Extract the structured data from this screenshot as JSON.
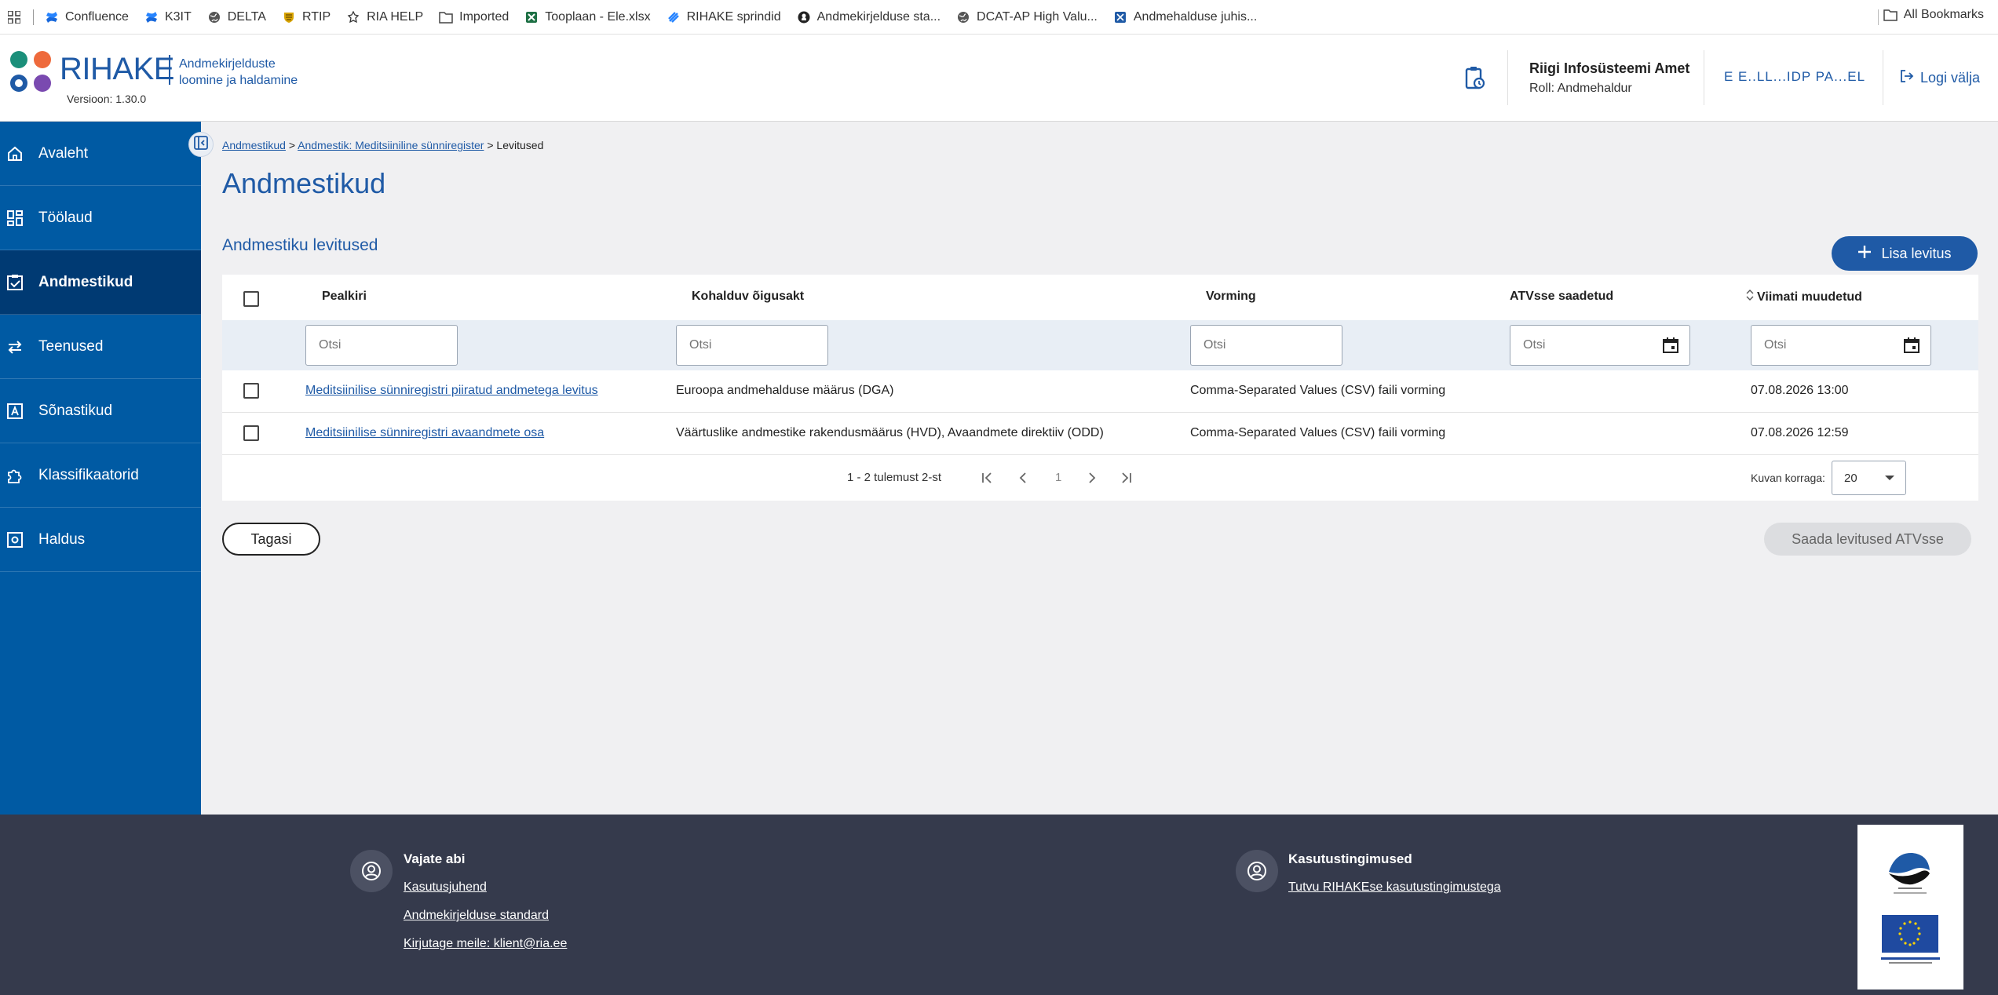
{
  "bookmarks": {
    "items": [
      {
        "label": "Confluence",
        "icon": "confluence-icon"
      },
      {
        "label": "K3IT",
        "icon": "confluence-icon"
      },
      {
        "label": "DELTA",
        "icon": "globe-icon"
      },
      {
        "label": "RTIP",
        "icon": "crest-icon"
      },
      {
        "label": "RIA HELP",
        "icon": "ria-icon"
      },
      {
        "label": "Imported",
        "icon": "folder-icon"
      },
      {
        "label": "Tooplaan - Ele.xlsx",
        "icon": "excel-icon"
      },
      {
        "label": "RIHAKE sprindid",
        "icon": "jira-icon"
      },
      {
        "label": "Andmekirjelduse sta...",
        "icon": "github-icon"
      },
      {
        "label": "DCAT-AP High Valu...",
        "icon": "globe-icon"
      },
      {
        "label": "Andmehalduse juhis...",
        "icon": "doc-icon"
      }
    ],
    "all_label": "All Bookmarks"
  },
  "header": {
    "logo": "RIHAKE",
    "subtitle_line1": "Andmekirjelduste",
    "subtitle_line2": "loomine ja haldamine",
    "version": "Versioon: 1.30.0",
    "org": "Riigi Infosüsteemi Amet",
    "role": "Roll: Andmehaldur",
    "panel": "E E..LL...IDP PA...EL",
    "logout": "Logi välja"
  },
  "sidebar": {
    "items": [
      {
        "label": "Avaleht",
        "icon": "home-icon",
        "active": false
      },
      {
        "label": "Töölaud",
        "icon": "dashboard-icon",
        "active": false
      },
      {
        "label": "Andmestikud",
        "icon": "dataset-check-icon",
        "active": true
      },
      {
        "label": "Teenused",
        "icon": "swap-arrows-icon",
        "active": false
      },
      {
        "label": "Sõnastikud",
        "icon": "dictionary-icon",
        "active": false
      },
      {
        "label": "Klassifikaatorid",
        "icon": "puzzle-icon",
        "active": false
      },
      {
        "label": "Haldus",
        "icon": "settings-box-icon",
        "active": false
      }
    ]
  },
  "breadcrumb": {
    "link1": "Andmestikud",
    "sep": " > ",
    "link2": "Andmestik: Meditsiiniline sünniregister",
    "current": "Levitused"
  },
  "page": {
    "title": "Andmestikud",
    "section": "Andmestiku levitused",
    "add_button": "Lisa levitus",
    "back_button": "Tagasi",
    "send_button": "Saada levitused ATVsse"
  },
  "table": {
    "columns": [
      "Pealkiri",
      "Kohalduv õigusakt",
      "Vorming",
      "ATVsse saadetud",
      "Viimati muudetud"
    ],
    "filter_placeholder": "Otsi",
    "rows": [
      {
        "title": "Meditsiinilise sünniregistri piiratud andmetega levitus",
        "law": "Euroopa andmehalduse määrus (DGA)",
        "format": "Comma-Separated Values (CSV) faili vorming",
        "sent": "",
        "modified": "07.08.2026 13:00"
      },
      {
        "title": "Meditsiinilise sünniregistri avaandmete osa",
        "law": "Väärtuslike andmestike rakendusmäärus (HVD), Avaandmete direktiiv (ODD)",
        "format": "Comma-Separated Values (CSV) faili vorming",
        "sent": "",
        "modified": "07.08.2026 12:59"
      }
    ],
    "pager": {
      "summary": "1 - 2 tulemust 2-st",
      "page": "1",
      "per_page_label": "Kuvan korraga:",
      "per_page": "20"
    }
  },
  "footer": {
    "help_title": "Vajate abi",
    "help_links": [
      "Kasutusjuhend",
      "Andmekirjelduse standard",
      "Kirjutage meile: klient@ria.ee"
    ],
    "terms_title": "Kasutustingimused",
    "terms_link": "Tutvu RIHAKEse kasutustingimustega"
  },
  "colors": {
    "brand": "#1f5aa6",
    "sidebar": "#005aa3",
    "sidebar_active": "#003a73",
    "footer": "#353a4c"
  }
}
